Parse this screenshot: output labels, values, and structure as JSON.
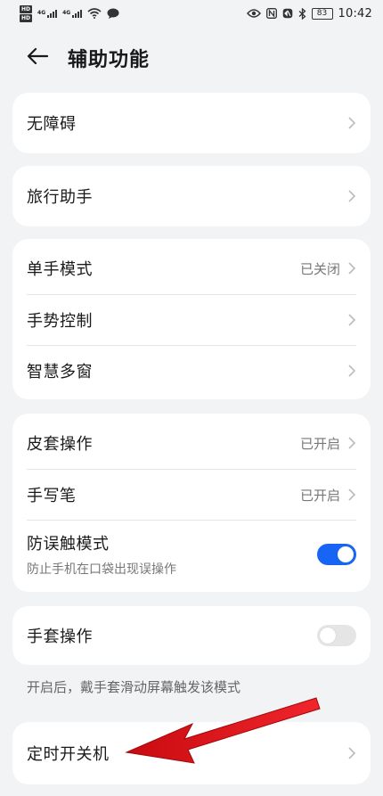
{
  "status_bar": {
    "hd_badges": [
      "HD",
      "HD"
    ],
    "net_labels": [
      "4G",
      "4G"
    ],
    "battery": "83",
    "time": "10:42",
    "icons": [
      "eye-icon",
      "nfc-icon",
      "mute-icon",
      "bluetooth-icon",
      "wifi-icon",
      "message-icon"
    ]
  },
  "header": {
    "title": "辅助功能",
    "back_icon": "back-arrow-icon"
  },
  "sections": {
    "accessibility": {
      "label": "无障碍"
    },
    "travel": {
      "label": "旅行助手"
    },
    "one_hand": {
      "label": "单手模式",
      "value": "已关闭"
    },
    "gesture": {
      "label": "手势控制"
    },
    "multi_window": {
      "label": "智慧多窗"
    },
    "cover": {
      "label": "皮套操作",
      "value": "已开启"
    },
    "stylus": {
      "label": "手写笔",
      "value": "已开启"
    },
    "pocket": {
      "label": "防误触模式",
      "sub": "防止手机在口袋出现误操作",
      "enabled": true
    },
    "glove": {
      "label": "手套操作",
      "enabled": false
    },
    "glove_note": "开启后，戴手套滑动屏幕触发该模式",
    "schedule_power": {
      "label": "定时开关机"
    }
  },
  "colors": {
    "accent": "#1864f5",
    "background": "#f1f3f5",
    "card": "#ffffff",
    "annotation_arrow": "#e8151b"
  }
}
